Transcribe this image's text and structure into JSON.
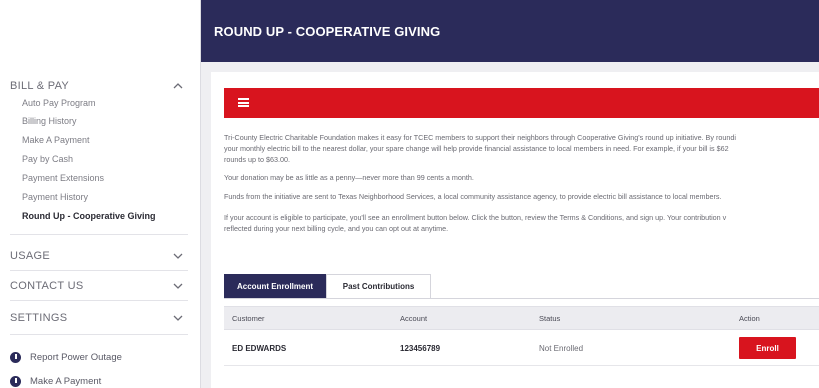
{
  "header": {
    "title": "ROUND UP - COOPERATIVE GIVING"
  },
  "sidebar": {
    "sections": [
      {
        "label": "BILL & PAY",
        "expanded": true,
        "chevron": "chevron-up-icon"
      },
      {
        "label": "USAGE",
        "expanded": false,
        "chevron": "chevron-down-icon"
      },
      {
        "label": "CONTACT US",
        "expanded": false,
        "chevron": "chevron-down-icon"
      },
      {
        "label": "SETTINGS",
        "expanded": false,
        "chevron": "chevron-down-icon"
      }
    ],
    "bill_pay_items": [
      "Auto Pay Program",
      "Billing History",
      "Make A Payment",
      "Pay by Cash",
      "Payment Extensions",
      "Payment History",
      "Round Up - Cooperative Giving"
    ],
    "active_item": "Round Up - Cooperative Giving",
    "quick_links": [
      {
        "label": "Report Power Outage",
        "icon": "alert-icon"
      },
      {
        "label": "Make A Payment",
        "icon": "alert-icon"
      }
    ]
  },
  "main": {
    "menu_icon": "hamburger-icon",
    "paragraphs": [
      "Tri-County Electric Charitable Foundation makes it easy for TCEC members to support their neighbors through Cooperative Giving's round up initiative. By roundi",
      "your monthly electric bill to the nearest dollar, your spare change will help provide financial assistance to local members in need. For example, if your bill is $62",
      "rounds up to $63.00.",
      "Your donation may be as little as a penny—never more than 99 cents a month.",
      "Funds from the initiative are sent to Texas Neighborhood Services, a local community assistance agency, to provide electric bill assistance to local members.",
      "If your account is eligible to participate, you'll see an enrollment button below. Click the button, review the Terms & Conditions, and sign up. Your contribution v",
      "reflected during your next billing cycle, and you can opt out at anytime."
    ],
    "tabs": [
      "Account Enrollment",
      "Past Contributions"
    ],
    "active_tab": "Account Enrollment",
    "table": {
      "columns": [
        "Customer",
        "Account",
        "Status",
        "Action"
      ],
      "rows": [
        {
          "customer": "ED EDWARDS",
          "account": "123456789",
          "status": "Not Enrolled",
          "action": "Enroll"
        }
      ]
    }
  },
  "colors": {
    "header_navy": "#2b2b5a",
    "accent_red": "#d8141e",
    "background_gray": "#efeff2"
  }
}
